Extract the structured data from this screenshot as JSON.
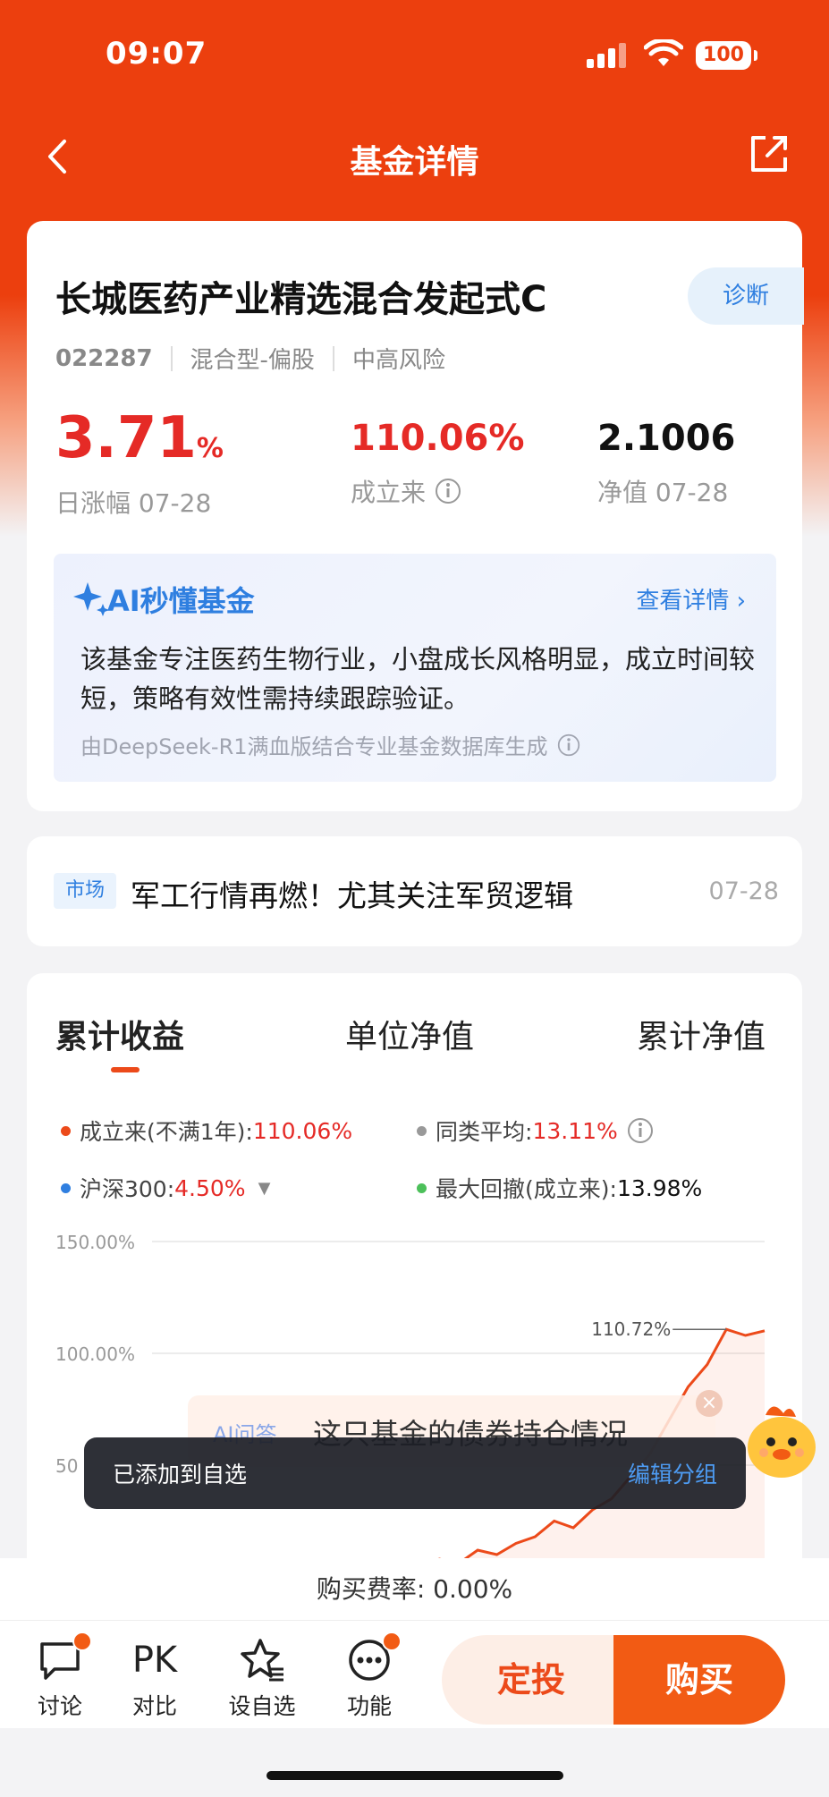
{
  "status_bar": {
    "time": "09:07",
    "battery": "100"
  },
  "nav": {
    "title": "基金详情"
  },
  "fund": {
    "name": "长城医药产业精选混合发起式C",
    "diagnose_label": "诊断",
    "code": "022287",
    "type": "混合型-偏股",
    "risk": "中高风险",
    "daily_change": "3.71",
    "daily_change_unit": "%",
    "daily_change_label": "日涨幅 07-28",
    "since_inception": "110.06%",
    "since_inception_label": "成立来",
    "nav_value": "2.1006",
    "nav_label": "净值 07-28"
  },
  "ai_summary": {
    "title": "AI秒懂基金",
    "more_label": "查看详情",
    "text": "该基金专注医药生物行业，小盘成长风格明显，成立时间较短，策略有效性需持续跟踪验证。",
    "footer": "由DeepSeek-R1满血版结合专业基金数据库生成"
  },
  "news": {
    "tag": "市场",
    "title": "军工行情再燃！尤其关注军贸逻辑",
    "date": "07-28"
  },
  "chart_tabs": [
    "累计收益",
    "单位净值",
    "累计净值"
  ],
  "legend": {
    "fund_label": "成立来(不满1年):",
    "fund_value": "110.06%",
    "peer_label": "同类平均:",
    "peer_value": "13.11%",
    "index_label": "沪深300:",
    "index_value": "4.50%",
    "drawdown_label": "最大回撤(成立来):",
    "drawdown_value": "13.98%"
  },
  "chart_data": {
    "type": "line",
    "yticks": [
      "150.00%",
      "100.00%",
      "50"
    ],
    "ylim": [
      0,
      150
    ],
    "peak_label": "110.72%",
    "series": [
      {
        "name": "成立来(不满1年)",
        "color": "#ec4a1a",
        "values": [
          5,
          8,
          6,
          12,
          10,
          15,
          18,
          25,
          22,
          30,
          35,
          45,
          55,
          70,
          85,
          95,
          110.72,
          108,
          110.06
        ]
      }
    ]
  },
  "ai_popup": {
    "prefix": "AI问答",
    "text": "这只基金的债券持仓情况"
  },
  "toast": {
    "text": "已添加到自选",
    "action": "编辑分组"
  },
  "fee": {
    "text": "购买费率: 0.00%"
  },
  "bottom_bar": {
    "discuss": "讨论",
    "pk": "PK",
    "compare": "对比",
    "watchlist": "设自选",
    "functions": "功能",
    "dingtou": "定投",
    "buy": "购买"
  },
  "colors": {
    "brand": "#ec3f0e",
    "rise": "#e52a26",
    "accent_blue": "#2f7fe0",
    "buy": "#f25b14"
  }
}
